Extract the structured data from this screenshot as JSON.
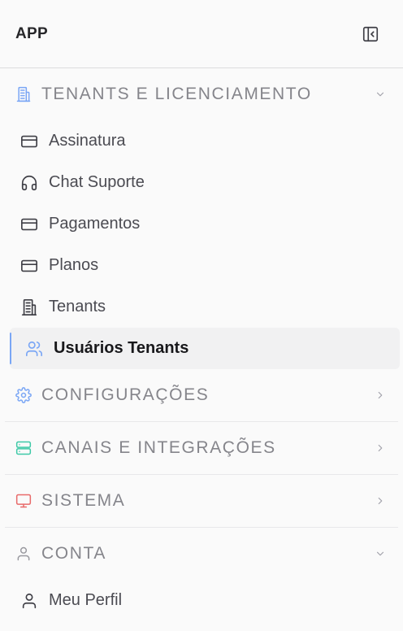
{
  "header": {
    "title": "APP",
    "toggle_icon": "sidebar-collapse-icon"
  },
  "sections": [
    {
      "label": "TENANTS E LICENCIAMENTO",
      "icon": "building-icon",
      "icon_color": "#7aa6f5",
      "expanded": true,
      "items": [
        {
          "label": "Assinatura",
          "icon": "credit-card-icon"
        },
        {
          "label": "Chat Suporte",
          "icon": "headphones-icon"
        },
        {
          "label": "Pagamentos",
          "icon": "credit-card-icon"
        },
        {
          "label": "Planos",
          "icon": "credit-card-icon"
        },
        {
          "label": "Tenants",
          "icon": "building-icon"
        },
        {
          "label": "Usuários Tenants",
          "icon": "users-icon",
          "active": true
        }
      ]
    },
    {
      "label": "CONFIGURAÇÕES",
      "icon": "gear-icon",
      "icon_color": "#7aa6f5",
      "expanded": false
    },
    {
      "label": "CANAIS E INTEGRAÇÕES",
      "icon": "server-icon",
      "icon_color": "#3ec9a7",
      "expanded": false
    },
    {
      "label": "SISTEMA",
      "icon": "monitor-icon",
      "icon_color": "#e86a6a",
      "expanded": false
    },
    {
      "label": "CONTA",
      "icon": "user-icon",
      "icon_color": "#9a9aa0",
      "expanded": true,
      "items": [
        {
          "label": "Meu Perfil",
          "icon": "user-icon"
        }
      ]
    }
  ],
  "colors": {
    "active_indicator": "#7aa6f5",
    "active_bg": "#f1f1f2",
    "section_text": "#85858b"
  }
}
